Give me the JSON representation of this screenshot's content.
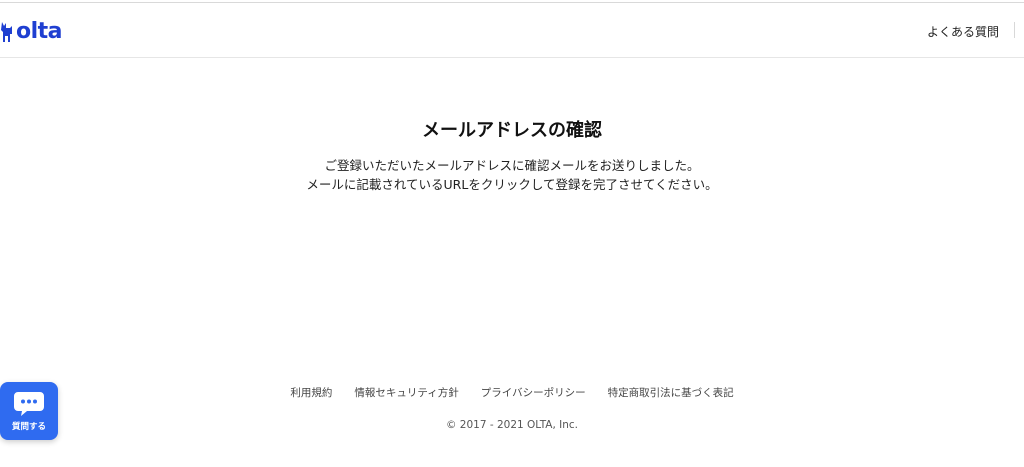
{
  "header": {
    "logo_text": "olta",
    "faq_label": "よくある質問"
  },
  "main": {
    "title": "メールアドレスの確認",
    "line1": "ご登録いただいたメールアドレスに確認メールをお送りしました。",
    "line2": "メールに記載されているURLをクリックして登録を完了させてください。"
  },
  "footer": {
    "links": [
      "利用規約",
      "情報セキュリティ方針",
      "プライバシーポリシー",
      "特定商取引法に基づく表記"
    ],
    "copyright": "© 2017 - 2021 OLTA, Inc."
  },
  "chat": {
    "label": "質問する",
    "icon": "chat-bubble-icon"
  },
  "colors": {
    "brand": "#1f3fd1",
    "chat_button": "#2f6bf0"
  }
}
